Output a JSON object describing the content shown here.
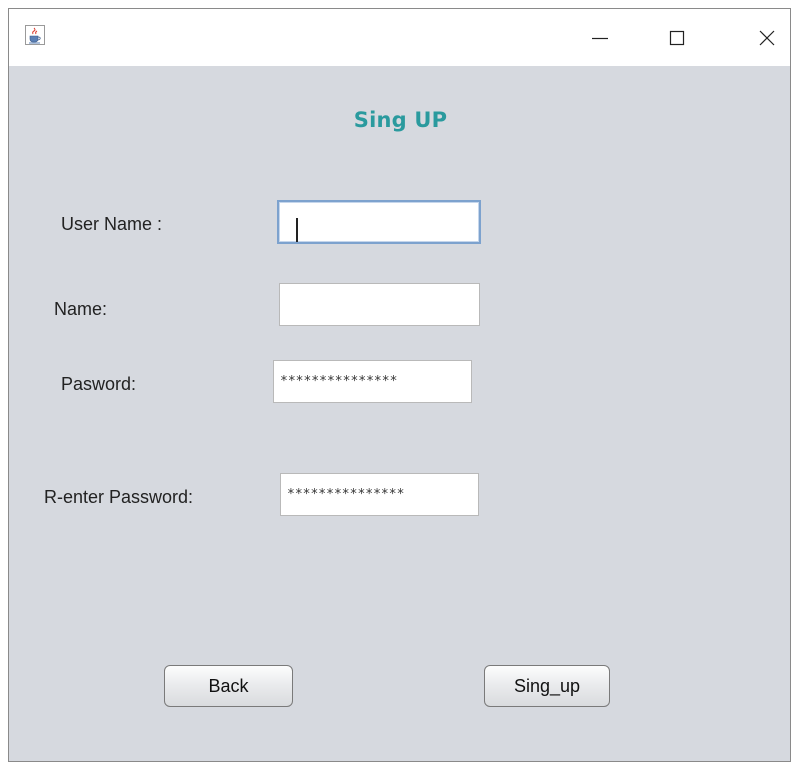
{
  "window": {
    "title": "",
    "icon": "java-cup-icon",
    "controls": {
      "minimize": "minimize-icon",
      "maximize": "maximize-icon",
      "close": "close-icon"
    }
  },
  "form": {
    "title": "Sing UP",
    "title_color": "#2a9a9e",
    "fields": {
      "username": {
        "label": "User Name :",
        "value": ""
      },
      "name": {
        "label": "Name:",
        "value": ""
      },
      "password": {
        "label": "Pasword:",
        "value": "***************"
      },
      "reenter_password": {
        "label": "R-enter Password:",
        "value": "***************"
      }
    }
  },
  "buttons": {
    "back": "Back",
    "sign_up": "Sing_up"
  }
}
